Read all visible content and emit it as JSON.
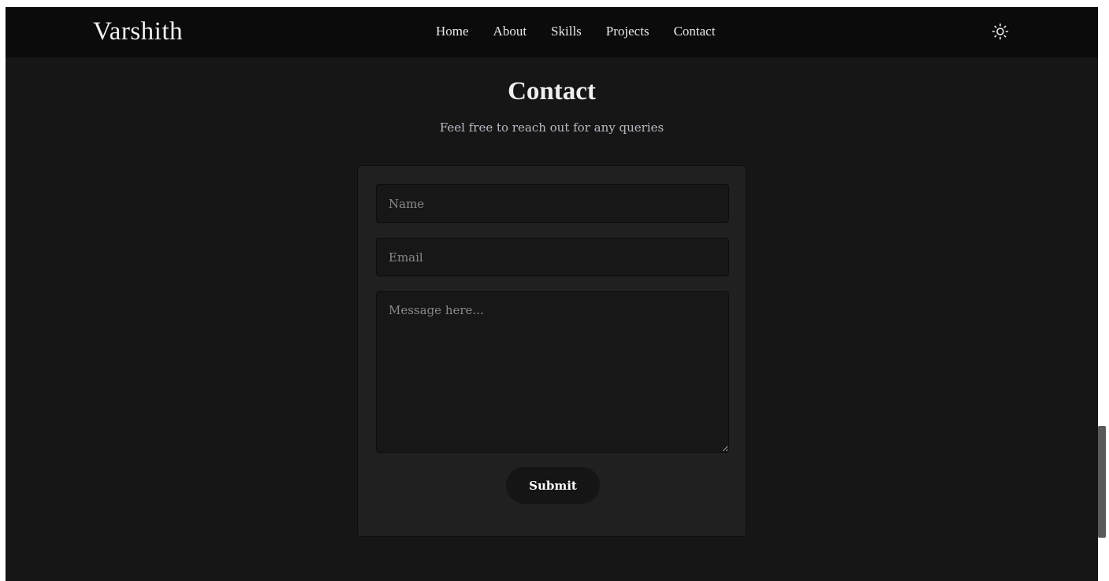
{
  "brand": "Varshith",
  "nav": {
    "items": [
      {
        "label": "Home"
      },
      {
        "label": "About"
      },
      {
        "label": "Skills"
      },
      {
        "label": "Projects"
      },
      {
        "label": "Contact"
      }
    ],
    "theme_icon": "sun-icon"
  },
  "contact": {
    "title": "Contact",
    "subtitle": "Feel free to reach out for any queries",
    "name_placeholder": "Name",
    "email_placeholder": "Email",
    "message_placeholder": "Message here...",
    "submit_label": "Submit"
  },
  "colors": {
    "background": "#161616",
    "navbar": "#0b0b0b",
    "card": "#202020",
    "input": "#171717",
    "text": "#f0f0f0",
    "subtitle": "#b9b9c4"
  }
}
